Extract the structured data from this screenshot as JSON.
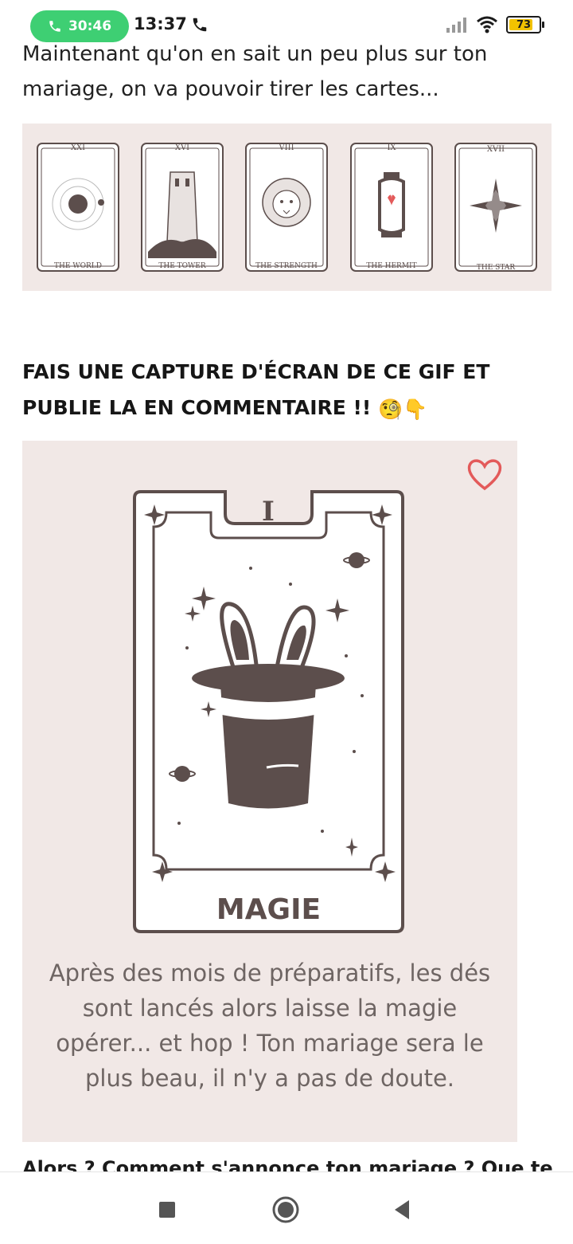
{
  "status_bar": {
    "call_timer": "30:46",
    "time": "13:37",
    "battery_level": "73",
    "icons": [
      "phone-icon",
      "signal-icon",
      "wifi-icon",
      "battery-icon"
    ]
  },
  "article": {
    "intro": "Maintenant qu'on en sait un peu plus sur ton mariage, on va pouvoir tirer les cartes...",
    "cards": [
      {
        "numeral": "XXI",
        "name": "THE WORLD"
      },
      {
        "numeral": "XVI",
        "name": "THE TOWER"
      },
      {
        "numeral": "VIII",
        "name": "THE STRENGTH"
      },
      {
        "numeral": "IX",
        "name": "THE HERMIT"
      },
      {
        "numeral": "XVII",
        "name": "THE STAR"
      }
    ],
    "heading": "FAIS UNE CAPTURE D'ÉCRAN DE CE GIF ET PUBLIE LA EN COMMENTAIRE !!",
    "heading_emojis": "🧐👇",
    "gif": {
      "card_numeral": "I",
      "card_title": "MAGIE",
      "description": "Après des mois de préparatifs, les dés sont lancés alors laisse la magie opérer... et hop ! Ton mariage sera le plus beau, il n'y a pas de doute."
    },
    "cut_off_text": "Alors ? Comment s'annonce ton mariage ? Que te"
  },
  "nav": {
    "buttons": [
      "recent-apps-button",
      "home-button",
      "back-button"
    ]
  },
  "colors": {
    "call_pill": "#3ecf73",
    "panel_bg": "#f1e8e6",
    "card_ink": "#5c4e4c",
    "heart": "#e35a5a",
    "battery": "#f2c200"
  }
}
